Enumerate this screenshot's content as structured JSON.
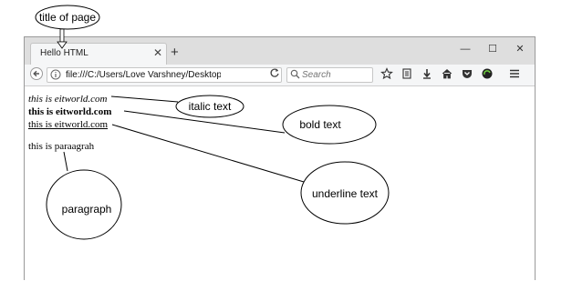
{
  "annotations": {
    "title_of_page": "title of page",
    "italic_text": "italic text",
    "bold_text": "bold text",
    "underline_text": "underline text",
    "paragraph": "paragraph"
  },
  "browser": {
    "tab_title": "Hello HTML",
    "tab_close": "✕",
    "new_tab": "+",
    "window_controls": {
      "minimize": "—",
      "maximize": "☐",
      "close": "✕"
    },
    "url": "file:///C:/Users/Love Varshney/Desktop/first.htm",
    "search_placeholder": "Search",
    "icons": [
      "back-arrow-icon",
      "info-icon",
      "reload-icon",
      "search-icon",
      "star-icon",
      "reading-list-icon",
      "download-icon",
      "home-icon",
      "pocket-icon",
      "extension-icon",
      "menu-icon"
    ]
  },
  "content": {
    "italic_line": "this is eitworld.com",
    "bold_line": "this is eitworld.com",
    "underline_line": "this is eitworld.com",
    "paragraph_line": "this is paraagrah"
  }
}
